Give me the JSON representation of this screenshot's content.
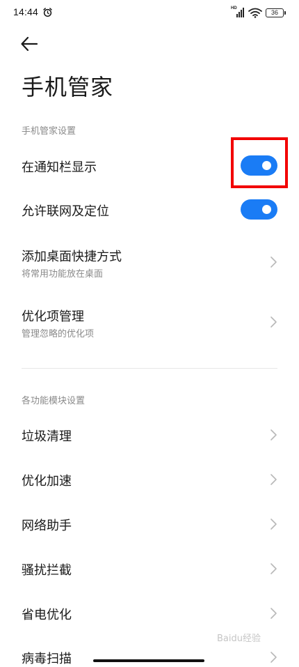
{
  "status_bar": {
    "time": "14:44",
    "network_label": "HD",
    "battery_level": "36"
  },
  "page": {
    "title": "手机管家"
  },
  "sections": [
    {
      "header": "手机管家设置",
      "items": [
        {
          "title": "在通知栏显示",
          "control": "toggle",
          "on": true
        },
        {
          "title": "允许联网及定位",
          "control": "toggle",
          "on": true
        },
        {
          "title": "添加桌面快捷方式",
          "subtitle": "将常用功能放在桌面",
          "control": "chevron"
        },
        {
          "title": "优化项管理",
          "subtitle": "管理忽略的优化项",
          "control": "chevron"
        }
      ]
    },
    {
      "header": "各功能模块设置",
      "items": [
        {
          "title": "垃圾清理",
          "control": "chevron"
        },
        {
          "title": "优化加速",
          "control": "chevron"
        },
        {
          "title": "网络助手",
          "control": "chevron"
        },
        {
          "title": "骚扰拦截",
          "control": "chevron"
        },
        {
          "title": "省电优化",
          "control": "chevron"
        },
        {
          "title": "病毒扫描",
          "control": "chevron"
        }
      ]
    }
  ],
  "colors": {
    "accent": "#1a7cf5",
    "highlight": "#f20000"
  },
  "watermark": "Baidu经验"
}
